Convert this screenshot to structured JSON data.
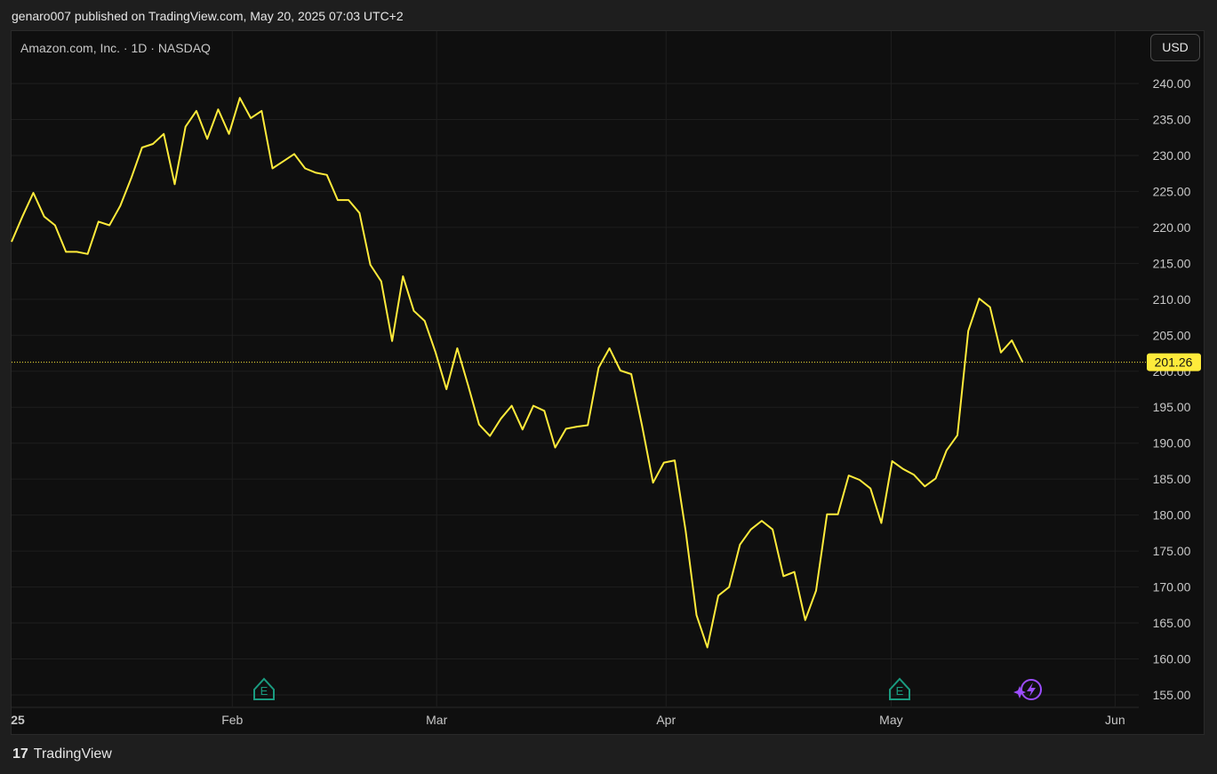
{
  "header": {
    "published_text": "genaro007 published on TradingView.com, May 20, 2025 07:03 UTC+2"
  },
  "legend": {
    "symbol_text": "Amazon.com, Inc. · 1D · NASDAQ"
  },
  "toolbar": {
    "currency_label": "USD"
  },
  "footer": {
    "brand_logo": "17",
    "brand_name": "TradingView"
  },
  "markers": {
    "earnings_label": "E",
    "earnings_color": "#1a9b80",
    "flash_icon": "lightning-icon",
    "flash_color": "#9c4dff"
  },
  "chart_data": {
    "type": "line",
    "line_color": "#ffeb3b",
    "grid": true,
    "ylim": [
      153.8,
      243.8
    ],
    "xlim": [
      0,
      103.55
    ],
    "yticks": [
      "155.00",
      "160.00",
      "165.00",
      "170.00",
      "175.00",
      "180.00",
      "185.00",
      "190.00",
      "195.00",
      "200.00",
      "205.00",
      "210.00",
      "215.00",
      "220.00",
      "225.00",
      "230.00",
      "235.00",
      "240.00"
    ],
    "ytick_values": [
      155,
      160,
      165,
      170,
      175,
      180,
      185,
      190,
      195,
      200,
      205,
      210,
      215,
      220,
      225,
      230,
      235,
      240
    ],
    "xticks": [
      {
        "label": "25",
        "x": 0
      },
      {
        "label": "Feb",
        "x": 20.3
      },
      {
        "label": "Mar",
        "x": 39.1
      },
      {
        "label": "Apr",
        "x": 60.2
      },
      {
        "label": "May",
        "x": 80.9
      },
      {
        "label": "Jun",
        "x": 101.5
      }
    ],
    "last_price": 201.26,
    "last_price_label": "201.26",
    "series": [
      {
        "values": [
          [
            0,
            218.0
          ],
          [
            1,
            221.5
          ],
          [
            2,
            224.8
          ],
          [
            3,
            221.5
          ],
          [
            4,
            220.3
          ],
          [
            5,
            216.6
          ],
          [
            6,
            216.6
          ],
          [
            7,
            216.3
          ],
          [
            8,
            220.8
          ],
          [
            9,
            220.3
          ],
          [
            10,
            223.0
          ],
          [
            11,
            226.8
          ],
          [
            12,
            231.1
          ],
          [
            13,
            231.6
          ],
          [
            14,
            233.0
          ],
          [
            15,
            226.0
          ],
          [
            16,
            234.0
          ],
          [
            17,
            236.2
          ],
          [
            18,
            232.3
          ],
          [
            19,
            236.4
          ],
          [
            20,
            233.0
          ],
          [
            21,
            238.0
          ],
          [
            22,
            235.2
          ],
          [
            23,
            236.2
          ],
          [
            24,
            228.2
          ],
          [
            25,
            229.2
          ],
          [
            26,
            230.2
          ],
          [
            27,
            228.2
          ],
          [
            28,
            227.6
          ],
          [
            29,
            227.3
          ],
          [
            30,
            223.8
          ],
          [
            31,
            223.8
          ],
          [
            32,
            222.0
          ],
          [
            33,
            214.8
          ],
          [
            34,
            212.5
          ],
          [
            35,
            204.2
          ],
          [
            36,
            213.2
          ],
          [
            37,
            208.4
          ],
          [
            38,
            207.0
          ],
          [
            39,
            202.6
          ],
          [
            40,
            197.5
          ],
          [
            41,
            203.2
          ],
          [
            42,
            198.0
          ],
          [
            43,
            192.6
          ],
          [
            44,
            191.0
          ],
          [
            45,
            193.4
          ],
          [
            46,
            195.2
          ],
          [
            47,
            191.9
          ],
          [
            48,
            195.2
          ],
          [
            49,
            194.5
          ],
          [
            50,
            189.4
          ],
          [
            51,
            192.0
          ],
          [
            52,
            192.3
          ],
          [
            53,
            192.5
          ],
          [
            54,
            200.5
          ],
          [
            55,
            203.2
          ],
          [
            56,
            200.1
          ],
          [
            57,
            199.6
          ],
          [
            58,
            192.4
          ],
          [
            59,
            184.5
          ],
          [
            60,
            187.3
          ],
          [
            61,
            187.6
          ],
          [
            62,
            177.8
          ],
          [
            63,
            166.1
          ],
          [
            64,
            161.6
          ],
          [
            65,
            168.8
          ],
          [
            66,
            170.0
          ],
          [
            67,
            175.9
          ],
          [
            68,
            178.0
          ],
          [
            69,
            179.2
          ],
          [
            70,
            178.0
          ],
          [
            71,
            171.5
          ],
          [
            72,
            172.1
          ],
          [
            73,
            165.4
          ],
          [
            74,
            169.5
          ],
          [
            75,
            180.1
          ],
          [
            76,
            180.1
          ],
          [
            77,
            185.5
          ],
          [
            78,
            184.9
          ],
          [
            79,
            183.7
          ],
          [
            80,
            178.9
          ],
          [
            81,
            187.5
          ],
          [
            82,
            186.4
          ],
          [
            83,
            185.6
          ],
          [
            84,
            184.0
          ],
          [
            85,
            185.1
          ],
          [
            86,
            189.0
          ],
          [
            87,
            191.1
          ],
          [
            88,
            205.6
          ],
          [
            89,
            210.1
          ],
          [
            90,
            208.9
          ],
          [
            91,
            202.6
          ],
          [
            92,
            204.3
          ],
          [
            93,
            201.26
          ]
        ]
      }
    ]
  }
}
